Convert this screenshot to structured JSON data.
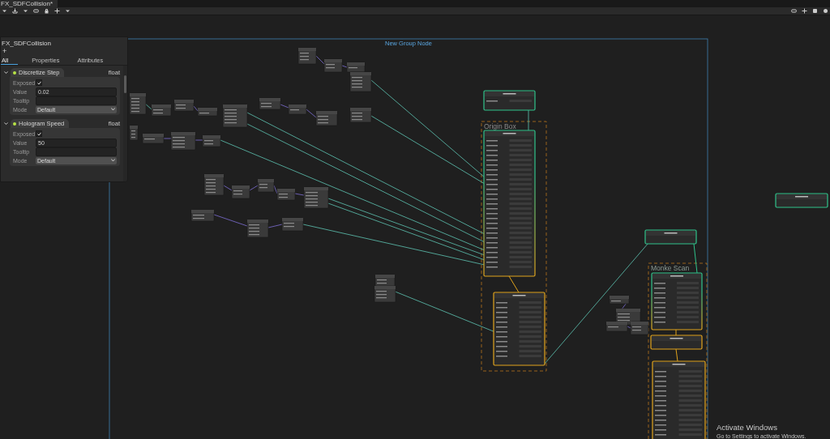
{
  "tab": {
    "title": "FX_SDFCollision*"
  },
  "blackboard": {
    "title": "FX_SDFCollision",
    "add": "+",
    "tabs": [
      {
        "label": "All",
        "selected": true
      },
      {
        "label": "Properties",
        "selected": false
      },
      {
        "label": "Attributes",
        "selected": false
      }
    ],
    "properties": [
      {
        "name": "Discretize Step",
        "type": "float",
        "expanded": true,
        "fields": [
          {
            "label": "Exposed",
            "kind": "checkbox",
            "checked": true
          },
          {
            "label": "Value",
            "kind": "text",
            "value": "0.02"
          },
          {
            "label": "Tooltip",
            "kind": "text"
          },
          {
            "label": "Mode",
            "kind": "dropdown",
            "value": "Default"
          }
        ]
      },
      {
        "name": "Hologram Speed",
        "type": "float",
        "expanded": true,
        "fields": [
          {
            "label": "Exposed",
            "kind": "checkbox",
            "checked": true
          },
          {
            "label": "Value",
            "kind": "text",
            "value": "50"
          },
          {
            "label": "Tooltip",
            "kind": "text"
          },
          {
            "label": "Mode",
            "kind": "dropdown",
            "value": "Default"
          }
        ]
      }
    ]
  },
  "graph": {
    "group": {
      "title": "New Group Node"
    },
    "subgroups": [
      {
        "title": "Origin Box"
      },
      {
        "title": "Monke Scan"
      }
    ]
  },
  "os_notice": {
    "title": "Activate Windows",
    "message": "Go to Settings to activate Windows."
  }
}
